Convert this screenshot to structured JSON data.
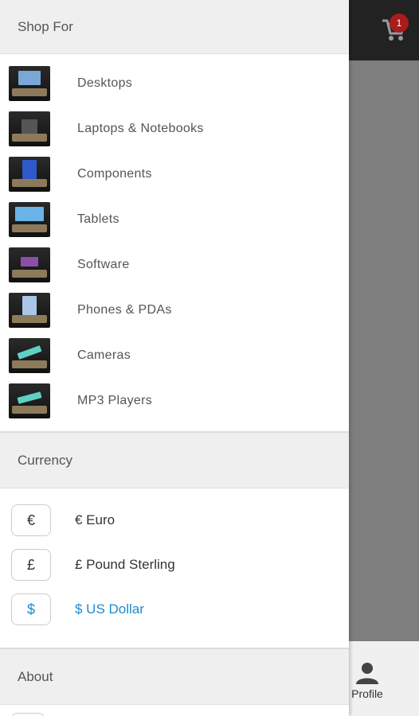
{
  "app": {
    "cart_count": "1",
    "profile_label": "Profile"
  },
  "drawer": {
    "shop_header": "Shop For",
    "categories": [
      {
        "label": "Desktops",
        "thumb": "desktop-thumb"
      },
      {
        "label": "Laptops & Notebooks",
        "thumb": "laptop-thumb"
      },
      {
        "label": "Components",
        "thumb": "component-thumb"
      },
      {
        "label": "Tablets",
        "thumb": "tablet-thumb"
      },
      {
        "label": "Software",
        "thumb": "software-thumb"
      },
      {
        "label": "Phones & PDAs",
        "thumb": "phone-thumb"
      },
      {
        "label": "Cameras",
        "thumb": "camera-thumb"
      },
      {
        "label": "MP3 Players",
        "thumb": "mp3-thumb"
      }
    ],
    "currency_header": "Currency",
    "currencies": [
      {
        "symbol": "€",
        "label": "€ Euro",
        "active": false
      },
      {
        "symbol": "£",
        "label": "£ Pound Sterling",
        "active": false
      },
      {
        "symbol": "$",
        "label": "$ US Dollar",
        "active": true
      }
    ],
    "about_header": "About"
  },
  "colors": {
    "accent": "#1b8bd1",
    "badge": "#a81c1c",
    "topbar": "#222222"
  }
}
